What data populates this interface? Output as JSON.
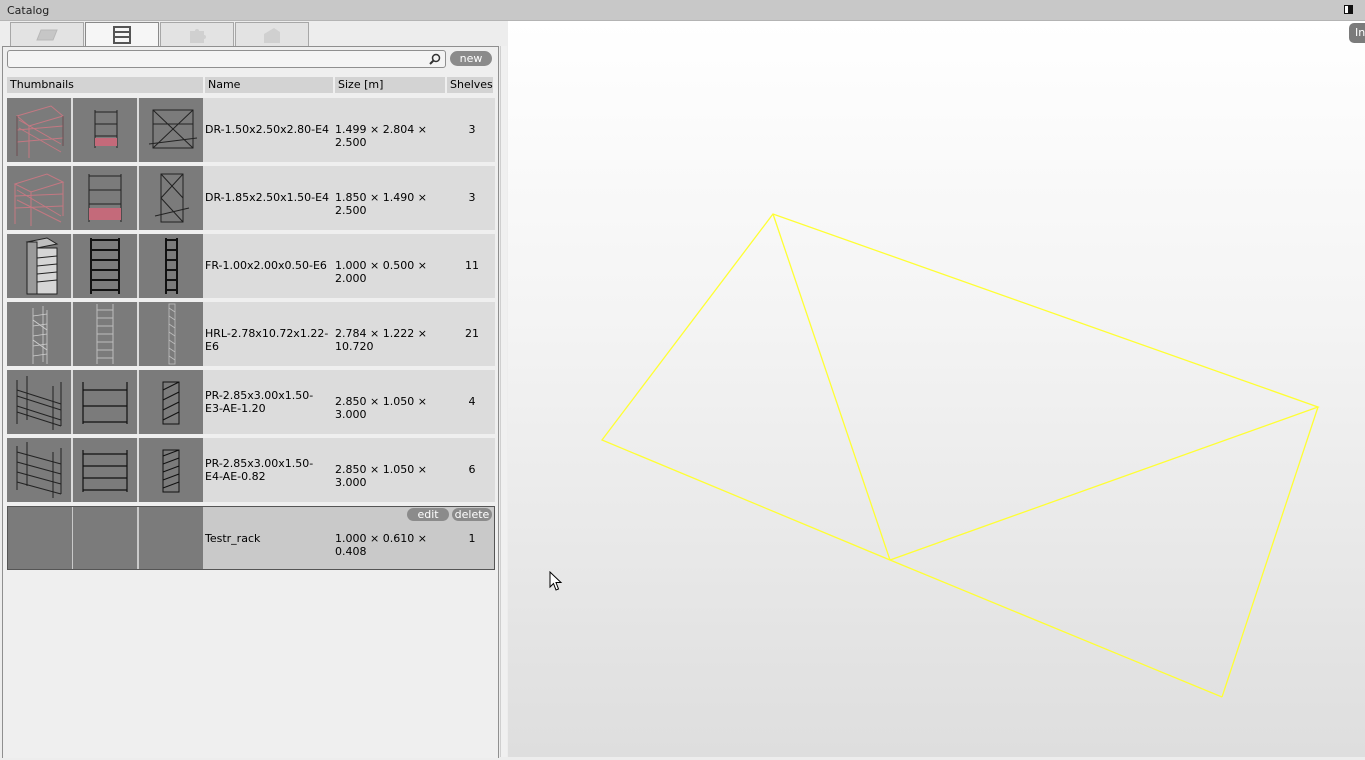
{
  "window": {
    "title": "Catalog"
  },
  "tabs": [
    {
      "icon": "floor-plan-icon",
      "active": false
    },
    {
      "icon": "rack-icon",
      "active": true
    },
    {
      "icon": "puzzle-icon",
      "active": false
    },
    {
      "icon": "building-icon",
      "active": false
    }
  ],
  "search": {
    "value": "",
    "placeholder": ""
  },
  "buttons": {
    "new": "new",
    "edit": "edit",
    "delete": "delete"
  },
  "table": {
    "columns": [
      "Thumbnails",
      "Name",
      "Size [m]",
      "Shelves"
    ],
    "rows": [
      {
        "name": "DR-1.50x2.50x2.80-E4",
        "size": "1.499 × 2.804 × 2.500",
        "shelves": "3"
      },
      {
        "name": "DR-1.85x2.50x1.50-E4",
        "size": "1.850 × 1.490 × 2.500",
        "shelves": "3"
      },
      {
        "name": "FR-1.00x2.00x0.50-E6",
        "size": "1.000 × 0.500 × 2.000",
        "shelves": "11"
      },
      {
        "name": "HRL-2.78x10.72x1.22-E6",
        "size": "2.784 × 1.222 × 10.720",
        "shelves": "21"
      },
      {
        "name": "PR-2.85x3.00x1.50-E3-AE-1.20",
        "size": "2.850 × 1.050 × 3.000",
        "shelves": "4"
      },
      {
        "name": "PR-2.85x3.00x1.50-E4-AE-0.82",
        "size": "2.850 × 1.050 × 3.000",
        "shelves": "6"
      },
      {
        "name": "Testr_rack",
        "size": "1.000 × 0.610 × 0.408",
        "shelves": "1"
      }
    ]
  },
  "viewport": {
    "info_button": "In",
    "wireframe_color": "#ffff33"
  },
  "colors": {
    "titlebar": "#c8c8c8",
    "button": "#8b8b8b",
    "thumbnail_bg": "#7b7b7b"
  }
}
